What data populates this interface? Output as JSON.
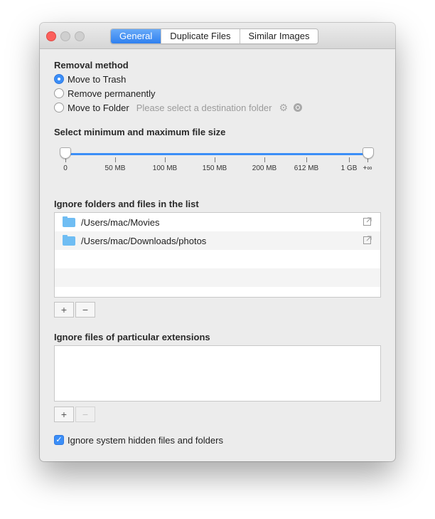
{
  "tabs": [
    "General",
    "Duplicate Files",
    "Similar Images"
  ],
  "removal": {
    "title": "Removal method",
    "options": [
      "Move to Trash",
      "Remove permanently",
      "Move to Folder"
    ],
    "selected": "Move to Trash",
    "destination_placeholder": "Please select a destination folder"
  },
  "size": {
    "title": "Select minimum and maximum file size",
    "ticks": [
      "0",
      "50 MB",
      "100 MB",
      "150 MB",
      "200 MB",
      "612 MB",
      "1 GB",
      "+∞"
    ],
    "min_value": "0",
    "max_value": "+∞"
  },
  "ignore_folders": {
    "title": "Ignore folders and files in the list",
    "items": [
      "/Users/mac/Movies",
      "/Users/mac/Downloads/photos"
    ]
  },
  "ignore_extensions": {
    "title": "Ignore files of particular extensions",
    "items": []
  },
  "buttons": {
    "add": "+",
    "remove": "−"
  },
  "hidden_files": {
    "label": "Ignore system hidden files and folders",
    "checked": true
  },
  "colors": {
    "accent": "#3b8ef7",
    "close": "#fc605c"
  },
  "icons": [
    "gear-icon",
    "magnifier-icon",
    "folder-icon",
    "reveal-icon"
  ]
}
